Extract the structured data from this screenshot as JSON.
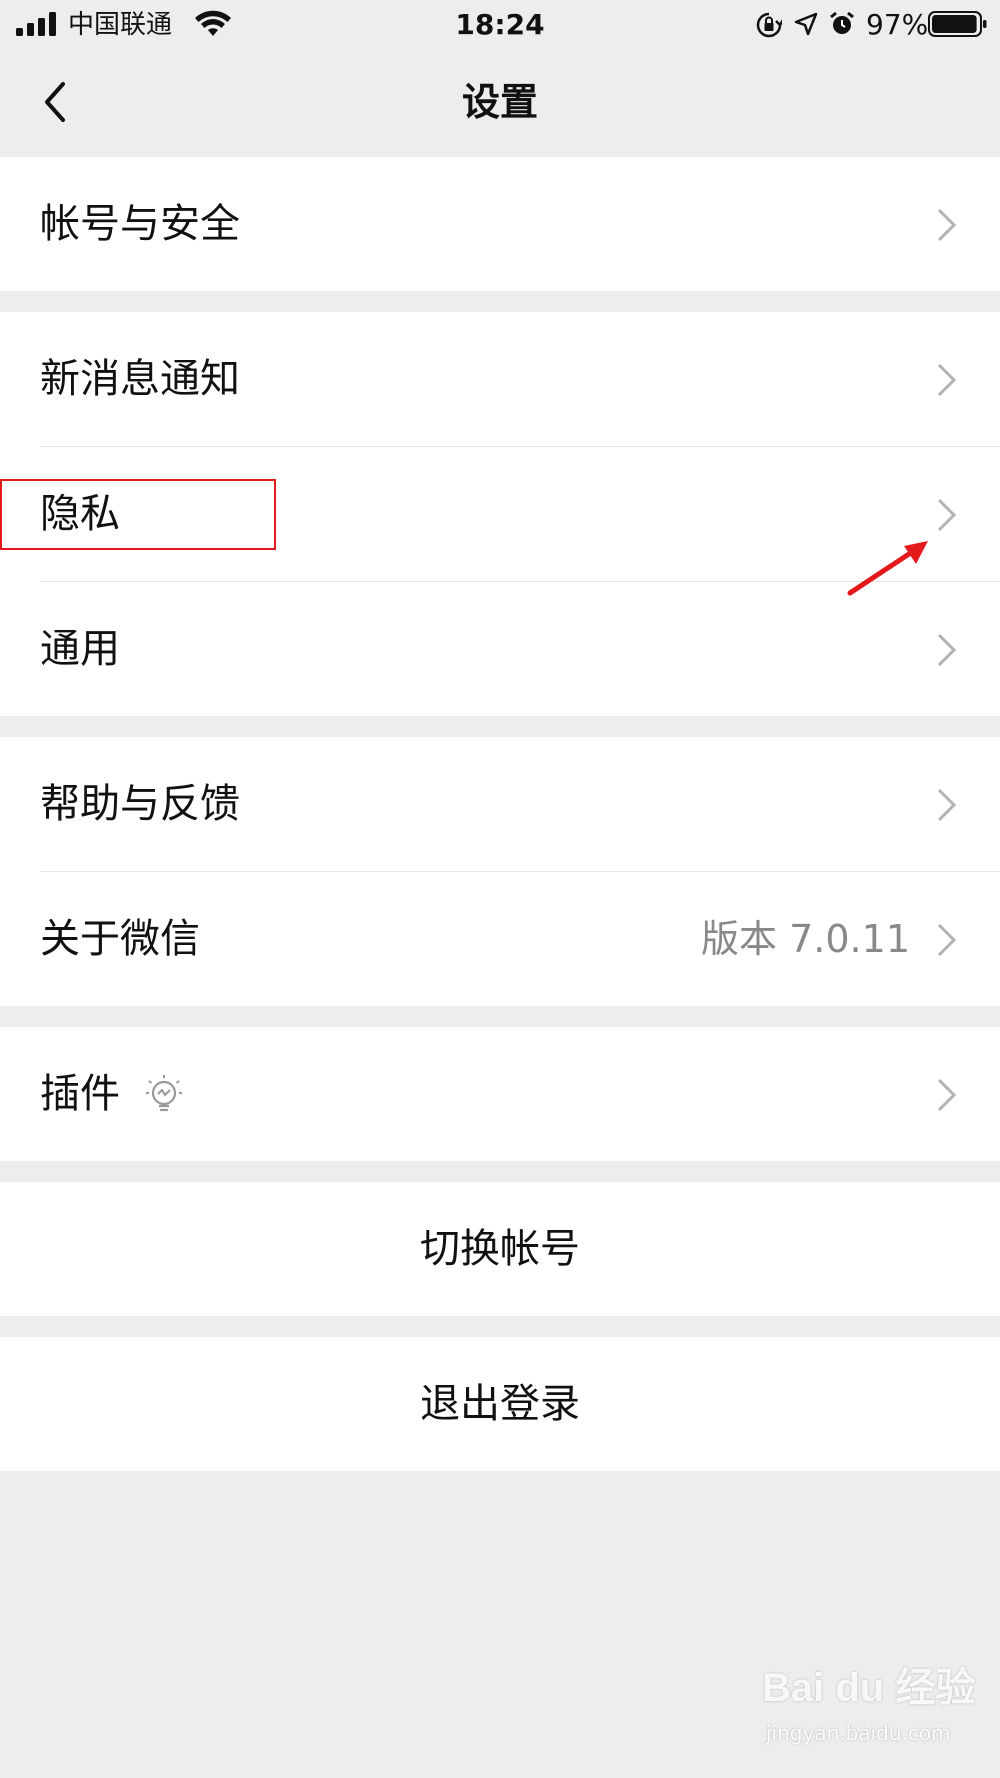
{
  "status_bar": {
    "carrier": "中国联通",
    "time": "18:24",
    "battery_percent": "97%",
    "battery_level": 0.97,
    "icons": [
      "signal-icon",
      "wifi-icon",
      "rotation-lock-icon",
      "location-icon",
      "alarm-icon",
      "battery-icon"
    ]
  },
  "nav": {
    "title": "设置",
    "back_icon": "chevron-left-icon"
  },
  "settings": {
    "account_security": "帐号与安全",
    "new_message_notify": "新消息通知",
    "privacy": "隐私",
    "general": "通用",
    "help_feedback": "帮助与反馈",
    "about_wechat": "关于微信",
    "about_version": "版本 7.0.11",
    "plugins": "插件",
    "plugins_icon": "lightbulb-icon",
    "switch_account": "切换帐号",
    "logout": "退出登录"
  },
  "annotation": {
    "highlight_color": "#e3191c",
    "arrow_color": "#e3191c"
  },
  "watermark": {
    "logo": "Bai du 经验",
    "url": "jingyan.baidu.com"
  },
  "colors": {
    "background": "#ededed",
    "cell": "#ffffff",
    "divider": "#e5e5e5",
    "secondary_text": "#888888"
  }
}
